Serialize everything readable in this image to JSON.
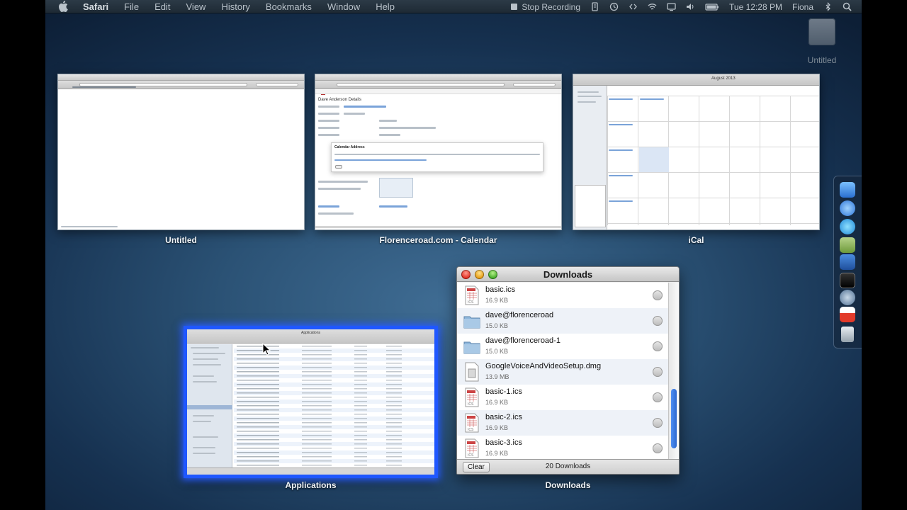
{
  "menubar": {
    "app_name": "Safari",
    "items": [
      "File",
      "Edit",
      "View",
      "History",
      "Bookmarks",
      "Window",
      "Help"
    ],
    "stop_recording": "Stop Recording",
    "clock": "Tue 12:28 PM",
    "user": "Fiona"
  },
  "desktop": {
    "drive_label": "Untitled"
  },
  "windows": {
    "untitled": {
      "caption": "Untitled"
    },
    "calendar": {
      "caption": "Florenceroad.com - Calendar",
      "heading": "Dave Anderson Details",
      "dialog_title": "Calendar Address"
    },
    "ical": {
      "caption": "iCal",
      "month": "August 2013"
    },
    "applications": {
      "caption": "Applications",
      "title": "Applications"
    },
    "downloads_caption": "Downloads"
  },
  "downloads": {
    "title": "Downloads",
    "items": [
      {
        "name": "basic.ics",
        "size": "16.9 KB",
        "icon": "ics-file-icon"
      },
      {
        "name": "dave@florenceroad",
        "size": "15.0 KB",
        "icon": "folder-icon"
      },
      {
        "name": "dave@florenceroad-1",
        "size": "15.0 KB",
        "icon": "folder-icon"
      },
      {
        "name": "GoogleVoiceAndVideoSetup.dmg",
        "size": "13.9 MB",
        "icon": "dmg-file-icon"
      },
      {
        "name": "basic-1.ics",
        "size": "16.9 KB",
        "icon": "ics-file-icon"
      },
      {
        "name": "basic-2.ics",
        "size": "16.9 KB",
        "icon": "ics-file-icon"
      },
      {
        "name": "basic-3.ics",
        "size": "16.9 KB",
        "icon": "ics-file-icon"
      }
    ],
    "clear_label": "Clear",
    "count_label": "20 Downloads"
  },
  "colors": {
    "selection_border": "#1f57ff",
    "menubar_bg": "#1e2a35"
  }
}
